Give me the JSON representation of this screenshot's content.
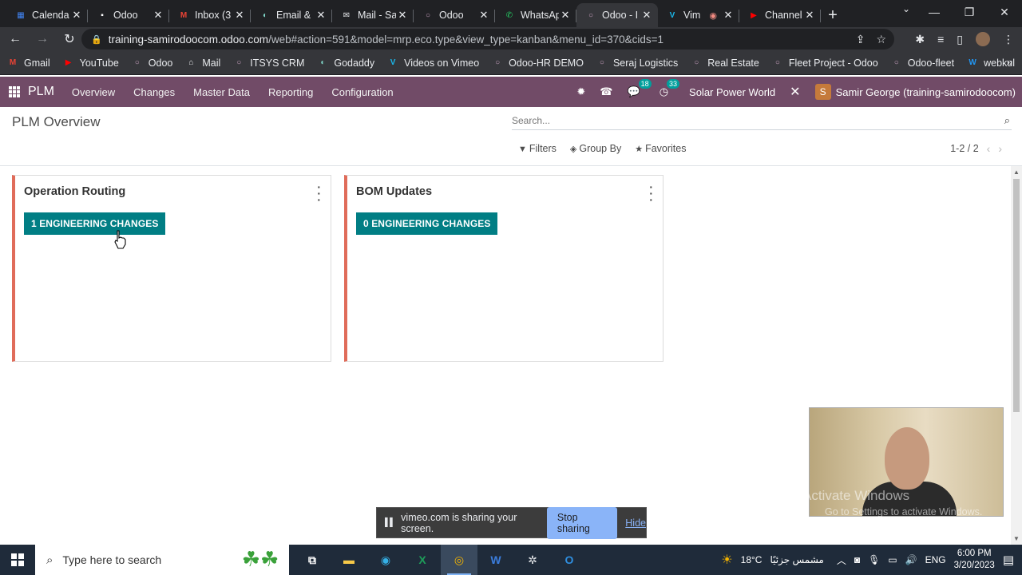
{
  "browser": {
    "tabs": [
      {
        "title": "Calenda",
        "favicon": "calendar-icon",
        "color": "#4285f4",
        "glyph": "▦"
      },
      {
        "title": "Odoo",
        "favicon": "odoo-doc-icon",
        "color": "#ffffff",
        "glyph": "▪"
      },
      {
        "title": "Inbox (3",
        "favicon": "gmail-icon",
        "color": "#ea4335",
        "glyph": "M"
      },
      {
        "title": "Email &",
        "favicon": "email-icon",
        "color": "#7fd6c8",
        "glyph": "◐"
      },
      {
        "title": "Mail - Sa",
        "favicon": "mail-icon",
        "color": "#e8eaed",
        "glyph": "✉"
      },
      {
        "title": "Odoo",
        "favicon": "odoo-icon",
        "color": "#c79fbe",
        "glyph": "○"
      },
      {
        "title": "WhatsAp",
        "favicon": "whatsapp-icon",
        "color": "#25d366",
        "glyph": "✆"
      },
      {
        "title": "Odoo - I",
        "favicon": "odoo-icon",
        "color": "#c79fbe",
        "glyph": "○",
        "active": true
      },
      {
        "title": "Vim",
        "favicon": "vimeo-icon",
        "color": "#1ab7ea",
        "glyph": "V",
        "recording": true
      },
      {
        "title": "Channel",
        "favicon": "youtube-icon",
        "color": "#ff0000",
        "glyph": "▶"
      }
    ],
    "url_host": "training-samirodoocom.odoo.com",
    "url_path": "/web#action=591&model=mrp.eco.type&view_type=kanban&menu_id=370&cids=1",
    "bookmarks": [
      {
        "label": "Gmail",
        "icon": "gmail-icon",
        "color": "#ea4335",
        "glyph": "M"
      },
      {
        "label": "YouTube",
        "icon": "youtube-icon",
        "color": "#ff0000",
        "glyph": "▶"
      },
      {
        "label": "Odoo",
        "icon": "odoo-icon",
        "color": "#c79fbe",
        "glyph": "○"
      },
      {
        "label": "Mail",
        "icon": "mail-icon",
        "color": "#e8eaed",
        "glyph": "⌂"
      },
      {
        "label": "ITSYS CRM",
        "icon": "odoo-icon",
        "color": "#c79fbe",
        "glyph": "○"
      },
      {
        "label": "Godaddy",
        "icon": "godaddy-icon",
        "color": "#7fd6c8",
        "glyph": "◐"
      },
      {
        "label": "Videos on Vimeo",
        "icon": "vimeo-icon",
        "color": "#1ab7ea",
        "glyph": "V"
      },
      {
        "label": "Odoo-HR DEMO",
        "icon": "odoo-icon",
        "color": "#c79fbe",
        "glyph": "○"
      },
      {
        "label": "Seraj Logistics",
        "icon": "odoo-icon",
        "color": "#c79fbe",
        "glyph": "○"
      },
      {
        "label": "Real Estate",
        "icon": "odoo-icon",
        "color": "#c79fbe",
        "glyph": "○"
      },
      {
        "label": "Fleet Project - Odoo",
        "icon": "odoo-icon",
        "color": "#c79fbe",
        "glyph": "○"
      },
      {
        "label": "Odoo-fleet",
        "icon": "odoo-icon",
        "color": "#c79fbe",
        "glyph": "○"
      },
      {
        "label": "webkul",
        "icon": "webkul-icon",
        "color": "#2196f3",
        "glyph": "W"
      }
    ]
  },
  "odoo": {
    "brand": "PLM",
    "menu": [
      "Overview",
      "Changes",
      "Master Data",
      "Reporting",
      "Configuration"
    ],
    "messages_count": "18",
    "activities_count": "33",
    "company": "Solar Power World",
    "user_initial": "S",
    "user": "Samir George (training-samirodoocom)",
    "accent": "#714b67"
  },
  "control_panel": {
    "title": "PLM Overview",
    "search_placeholder": "Search...",
    "filters": "Filters",
    "group_by": "Group By",
    "favorites": "Favorites",
    "pager": "1-2 / 2"
  },
  "kanban": {
    "cards": [
      {
        "title": "Operation Routing",
        "button": "1 ENGINEERING CHANGES"
      },
      {
        "title": "BOM Updates",
        "button": "0 ENGINEERING CHANGES"
      }
    ],
    "button_color": "#017e84",
    "card_stripe_color": "#e06c5a"
  },
  "overlay": {
    "activate_title": "Activate Windows",
    "activate_sub": "Go to Settings to activate Windows."
  },
  "share_banner": {
    "text": "vimeo.com is sharing your screen.",
    "stop": "Stop sharing",
    "hide": "Hide"
  },
  "taskbar": {
    "search_placeholder": "Type here to search",
    "weather": "18°C",
    "weather_text": "مشمس جزئيًا",
    "lang": "ENG",
    "time": "6:00 PM",
    "date": "3/20/2023"
  }
}
